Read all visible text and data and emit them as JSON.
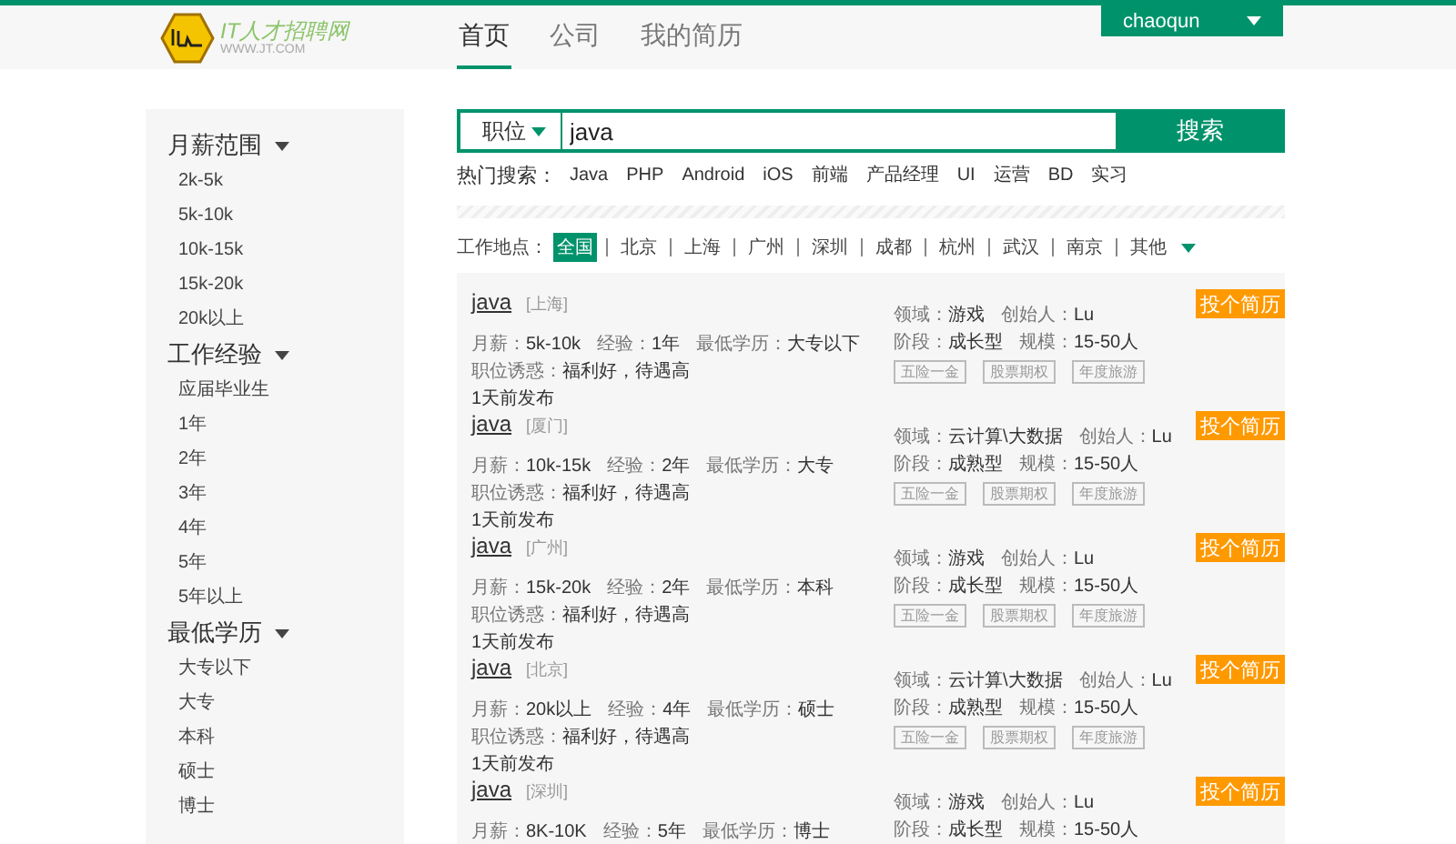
{
  "header": {
    "logo_text": "IT人才招聘网",
    "logo_subtext": "WWW.JT.COM",
    "nav": [
      {
        "label": "首页",
        "selected": true
      },
      {
        "label": "公司",
        "selected": false
      },
      {
        "label": "我的简历",
        "selected": false
      }
    ],
    "user": {
      "name": "chaoqun"
    }
  },
  "filters": [
    {
      "title": "月薪范围",
      "items": [
        "2k-5k",
        "5k-10k",
        "10k-15k",
        "15k-20k",
        "20k以上"
      ]
    },
    {
      "title": "工作经验",
      "items": [
        "应届毕业生",
        "1年",
        "2年",
        "3年",
        "4年",
        "5年",
        "5年以上"
      ]
    },
    {
      "title": "最低学历",
      "items": [
        "大专以下",
        "大专",
        "本科",
        "硕士",
        "博士"
      ]
    }
  ],
  "search": {
    "category": "职位",
    "value": "java",
    "button": "搜索"
  },
  "hot_search": {
    "label": "热门搜索：",
    "items": [
      "Java",
      "PHP",
      "Android",
      "iOS",
      "前端",
      "产品经理",
      "UI",
      "运营",
      "BD",
      "实习"
    ]
  },
  "locations": {
    "label": "工作地点：",
    "items": [
      {
        "label": "全国",
        "selected": true
      },
      {
        "label": "北京",
        "selected": false
      },
      {
        "label": "上海",
        "selected": false
      },
      {
        "label": "广州",
        "selected": false
      },
      {
        "label": "深圳",
        "selected": false
      },
      {
        "label": "成都",
        "selected": false
      },
      {
        "label": "杭州",
        "selected": false
      },
      {
        "label": "武汉",
        "selected": false
      },
      {
        "label": "南京",
        "selected": false
      },
      {
        "label": "其他",
        "selected": false
      }
    ]
  },
  "jobs": [
    {
      "title": "java",
      "city": "[上海]",
      "details": [
        {
          "label": "月薪：",
          "value": "5k-10k"
        },
        {
          "label": "经验：",
          "value": "1年"
        },
        {
          "label": "最低学历：",
          "value": "大专以下"
        }
      ],
      "perks": {
        "label": "职位诱惑：",
        "value": "福利好，待遇高"
      },
      "posted": "1天前发布",
      "company": [
        [
          {
            "label": "领域：",
            "value": "游戏"
          },
          {
            "label": "创始人：",
            "value": "Lu"
          }
        ],
        [
          {
            "label": "阶段：",
            "value": "成长型"
          },
          {
            "label": "规模：",
            "value": "15-50人"
          }
        ]
      ],
      "tags": [
        "五险一金",
        "股票期权",
        "年度旅游"
      ],
      "apply": "投个简历"
    },
    {
      "title": "java",
      "city": "[厦门]",
      "details": [
        {
          "label": "月薪：",
          "value": "10k-15k"
        },
        {
          "label": "经验：",
          "value": "2年"
        },
        {
          "label": "最低学历：",
          "value": "大专"
        }
      ],
      "perks": {
        "label": "职位诱惑：",
        "value": "福利好，待遇高"
      },
      "posted": "1天前发布",
      "company": [
        [
          {
            "label": "领域：",
            "value": "云计算\\大数据"
          },
          {
            "label": "创始人：",
            "value": "Lu"
          }
        ],
        [
          {
            "label": "阶段：",
            "value": "成熟型"
          },
          {
            "label": "规模：",
            "value": "15-50人"
          }
        ]
      ],
      "tags": [
        "五险一金",
        "股票期权",
        "年度旅游"
      ],
      "apply": "投个简历"
    },
    {
      "title": "java",
      "city": "[广州]",
      "details": [
        {
          "label": "月薪：",
          "value": "15k-20k"
        },
        {
          "label": "经验：",
          "value": "2年"
        },
        {
          "label": "最低学历：",
          "value": "本科"
        }
      ],
      "perks": {
        "label": "职位诱惑：",
        "value": "福利好，待遇高"
      },
      "posted": "1天前发布",
      "company": [
        [
          {
            "label": "领域：",
            "value": "游戏"
          },
          {
            "label": "创始人：",
            "value": "Lu"
          }
        ],
        [
          {
            "label": "阶段：",
            "value": "成长型"
          },
          {
            "label": "规模：",
            "value": "15-50人"
          }
        ]
      ],
      "tags": [
        "五险一金",
        "股票期权",
        "年度旅游"
      ],
      "apply": "投个简历"
    },
    {
      "title": "java",
      "city": "[北京]",
      "details": [
        {
          "label": "月薪：",
          "value": "20k以上"
        },
        {
          "label": "经验：",
          "value": "4年"
        },
        {
          "label": "最低学历：",
          "value": "硕士"
        }
      ],
      "perks": {
        "label": "职位诱惑：",
        "value": "福利好，待遇高"
      },
      "posted": "1天前发布",
      "company": [
        [
          {
            "label": "领域：",
            "value": "云计算\\大数据"
          },
          {
            "label": "创始人：",
            "value": "Lu"
          }
        ],
        [
          {
            "label": "阶段：",
            "value": "成熟型"
          },
          {
            "label": "规模：",
            "value": "15-50人"
          }
        ]
      ],
      "tags": [
        "五险一金",
        "股票期权",
        "年度旅游"
      ],
      "apply": "投个简历"
    },
    {
      "title": "java",
      "city": "[深圳]",
      "details": [
        {
          "label": "月薪：",
          "value": "8K-10K"
        },
        {
          "label": "经验：",
          "value": "5年"
        },
        {
          "label": "最低学历：",
          "value": "博士"
        }
      ],
      "company": [
        [
          {
            "label": "领域：",
            "value": "游戏"
          },
          {
            "label": "创始人：",
            "value": "Lu"
          }
        ],
        [
          {
            "label": "阶段：",
            "value": "成长型"
          },
          {
            "label": "规模：",
            "value": "15-50人"
          }
        ]
      ],
      "apply": "投个简历"
    }
  ]
}
